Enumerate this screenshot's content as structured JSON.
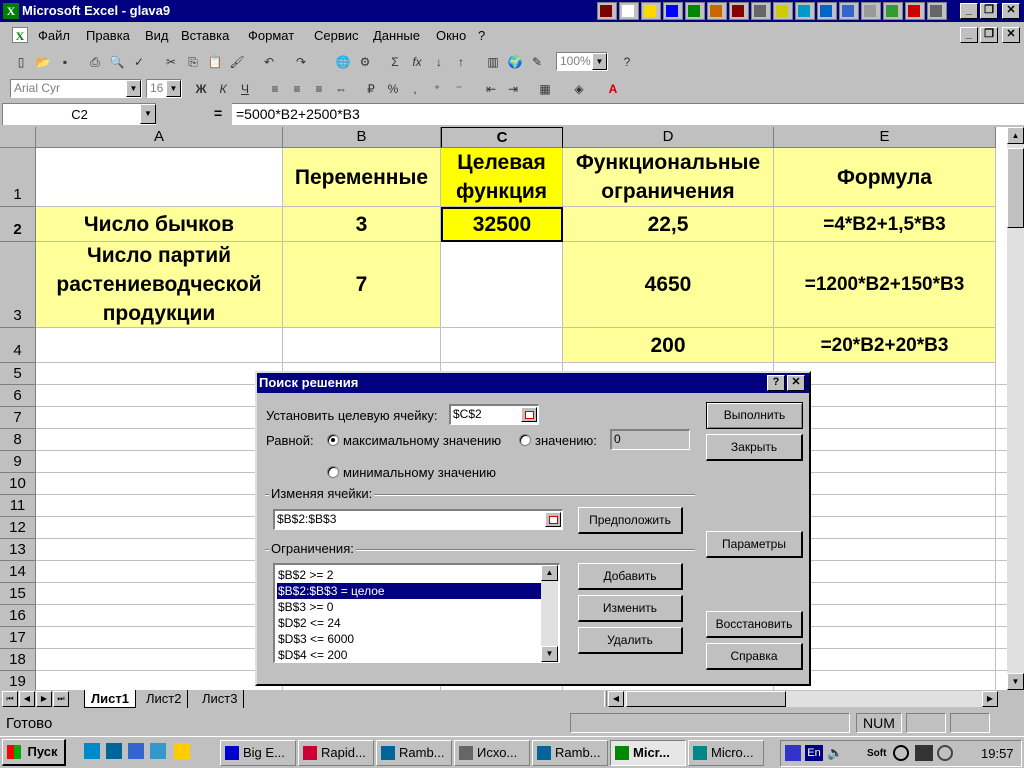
{
  "app": {
    "title": "Microsoft Excel - glava9"
  },
  "menu": [
    "Файл",
    "Правка",
    "Вид",
    "Вставка",
    "Формат",
    "Сервис",
    "Данные",
    "Окно",
    "?"
  ],
  "toolbar": {
    "zoom": "100%",
    "font": "Arial Cyr",
    "size": "16",
    "bold": "Ж",
    "italic": "К",
    "underline": "Ч",
    "sigma": "Σ",
    "fx": "fx",
    "percent": "%"
  },
  "formula_bar": {
    "name_box": "C2",
    "equals": "=",
    "formula": "=5000*B2+2500*B3"
  },
  "columns": [
    "A",
    "B",
    "C",
    "D",
    "E"
  ],
  "rows": [
    "1",
    "2",
    "3",
    "4",
    "5",
    "6",
    "7",
    "8",
    "9",
    "10",
    "11",
    "12",
    "13",
    "14",
    "15",
    "16",
    "17",
    "18",
    "19"
  ],
  "cells": {
    "B1": "Переменные",
    "C1": "Целевая функция",
    "D1": "Функциональные ограничения",
    "E1": "Формула",
    "A2": "Число бычков",
    "B2": "3",
    "C2": "32500",
    "D2": "22,5",
    "E2": "=4*B2+1,5*B3",
    "A3": "Число партий растениеводческой продукции",
    "B3": "7",
    "D3": "4650",
    "E3": "=1200*B2+150*B3",
    "D4": "200",
    "E4": "=20*B2+20*B3"
  },
  "sheet_tabs": [
    "Лист1",
    "Лист2",
    "Лист3"
  ],
  "status": {
    "text": "Готово",
    "num": "NUM"
  },
  "dialog": {
    "title": "Поиск решения",
    "target_label": "Установить целевую ячейку:",
    "target_value": "$C$2",
    "equal_label": "Равной:",
    "opt_max": "максимальному значению",
    "opt_value": "значению:",
    "value_field": "0",
    "opt_min": "минимальному значению",
    "changing_label": "Изменяя ячейки:",
    "changing_value": "$B$2:$B$3",
    "guess_button": "Предположить",
    "constraints_label": "Ограничения:",
    "constraints": [
      "$B$2 >= 2",
      "$B$2:$B$3 = целое",
      "$B$3 >= 0",
      "$D$2 <= 24",
      "$D$3 <= 6000",
      "$D$4 <= 200"
    ],
    "selected_constraint": 1,
    "add_button": "Добавить",
    "change_button": "Изменить",
    "delete_button": "Удалить",
    "solve_button": "Выполнить",
    "close_button": "Закрыть",
    "options_button": "Параметры",
    "reset_button": "Восстановить",
    "help_button": "Справка"
  },
  "taskbar": {
    "start": "Пуск",
    "tasks": [
      "Big E...",
      "Rapid...",
      "Ramb...",
      "Исхо...",
      "Ramb...",
      "Micr...",
      "Micro..."
    ],
    "active_task": 5,
    "lang": "En",
    "soft": "Soft",
    "clock": "19:57"
  },
  "colors": {
    "title_bar": "#000080",
    "cell_fill": "#ffff99",
    "highlight": "#000080"
  }
}
